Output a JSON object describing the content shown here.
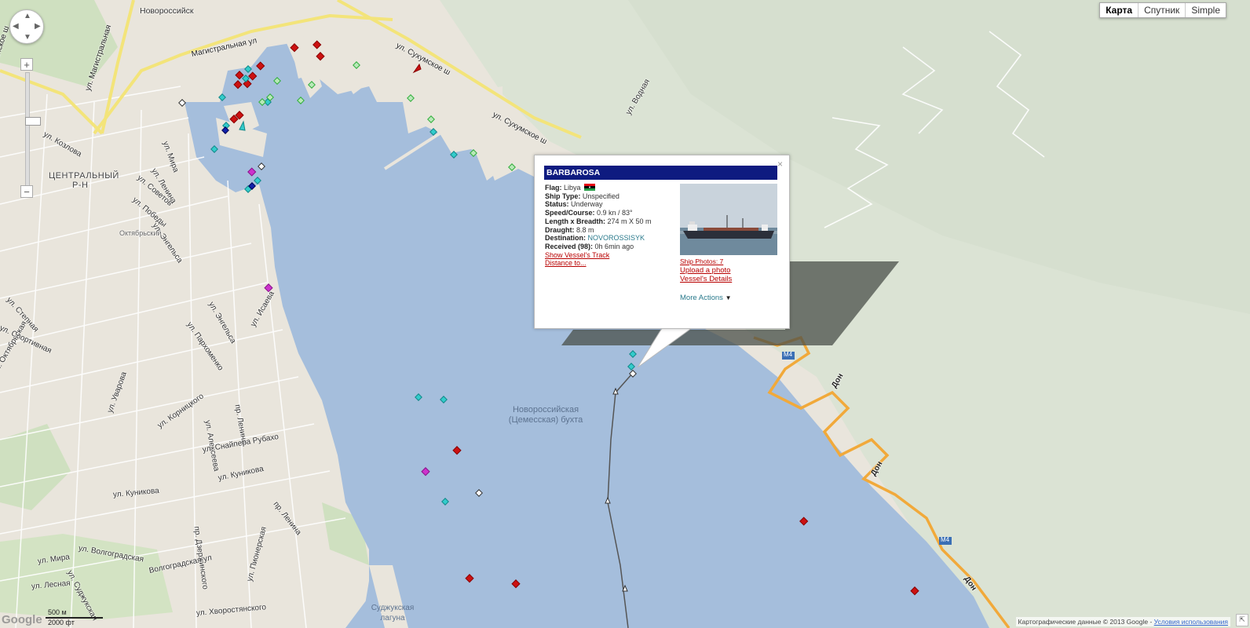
{
  "map_type": {
    "options": [
      "Карта",
      "Спутник",
      "Simple"
    ],
    "selected": "Карта"
  },
  "zoom_controls": {
    "plus": "+",
    "minus": "−"
  },
  "labels": {
    "novorossiysk": "Новороссийск",
    "central_district_1": "ЦЕНТРАЛЬНЫЙ",
    "central_district_2": "Р-Н",
    "oktyabrsky": "Октябрьский",
    "bay_line1": "Новороссийская",
    "bay_line2": "(Цемесская) бухта",
    "lagoon_line1": "Суджукская",
    "lagoon_line2": "лагуна",
    "magistralnaya": "Магистральная ул",
    "sukhumskoe1": "ул. Сухумское ш",
    "sukhumskoe2": "ул. Сухумское ш",
    "ul_magistralnaya": "ул. Магистральная",
    "anapskoe": "Анапское ш",
    "kozlova": "ул. Козлова",
    "mira": "ул. Мира",
    "sovetov": "ул. Советов",
    "lenina": "ул. Ленина",
    "pobedy": "ул. Победы",
    "engelsa": "ул. Энгельса",
    "engelsa2": "ул. Энгельса",
    "parkhomenko": "ул. Пархоменко",
    "isaeva": "ул. Исаева",
    "stepnaya": "ул. Степная",
    "sportivnaya": "ул. Спортивная",
    "oktyabrskaya": "ул. Октябрьская",
    "vodnaya": "ул. Водная",
    "kornitskogo": "ул. Корницкого",
    "alekseeva": "ул. Алексеева",
    "lenina_pr": "пр. Ленина",
    "lenina_pr2": "пр. Ленина",
    "snaipera": "ул. Снайпера Рубахо",
    "kunikova": "ул. Куникова",
    "kunikova2": "ул. Куникова",
    "dzerzhinskogo": "пр. Дзержинского",
    "volgogradskaya": "ул. Волгоградская",
    "volgogradskaya2": "Волгоградская ул",
    "sudzhukskaya": "ул. Суджукская",
    "mira2": "ул. Мира",
    "lesnaya": "ул. Лесная",
    "pionerskaya": "ул. Пионерская",
    "khvorostyanskogo": "ул. Хворостянского",
    "uvarova": "ул. Уварова",
    "don1": "Дон",
    "don2": "Дон",
    "don3": "Дон",
    "m4a": "M4",
    "m4b": "M4"
  },
  "vessel_popup": {
    "name": "BARBAROSA",
    "close": "×",
    "flag_label": "Flag:",
    "flag": "Libya",
    "ship_type_label": "Ship Type:",
    "ship_type": "Unspecified",
    "status_label": "Status:",
    "status": "Underway",
    "speed_label": "Speed/Course:",
    "speed": "0.9 kn / 83°",
    "length_label": "Length x Breadth:",
    "length": "274 m X 50 m",
    "draught_label": "Draught:",
    "draught": "8.8 m",
    "destination_label": "Destination:",
    "destination": "NOVOROSSISYK",
    "received_label": "Received (98):",
    "received": "0h 6min ago",
    "show_track": "Show Vessel's Track",
    "distance": "Distance to...",
    "ship_photos": "Ship Photos: 7",
    "upload_photo": "Upload a photo",
    "vessel_details": "Vessel's Details",
    "more_actions": "More Actions"
  },
  "scale": {
    "metric": "500 м",
    "imperial": "2000 фт"
  },
  "footer": {
    "data": "Картографические данные © 2013 Google - ",
    "terms": "Условия использования"
  },
  "google_logo": "Google",
  "colors": {
    "water": "#a5bedc",
    "land": "#e9e5dc",
    "green": "#d4e3c5",
    "hills": "#d9e2d2",
    "cargo_red": "#cc1111",
    "tanker_cyan": "#33cccc",
    "tug_green": "#2fae3a",
    "passenger_blue": "#1122aa",
    "special_magenta": "#cc33cc",
    "unknown_gray": "#ffffff",
    "highway_orange": "#f1a93a",
    "road_yellow": "#f3e47a"
  }
}
